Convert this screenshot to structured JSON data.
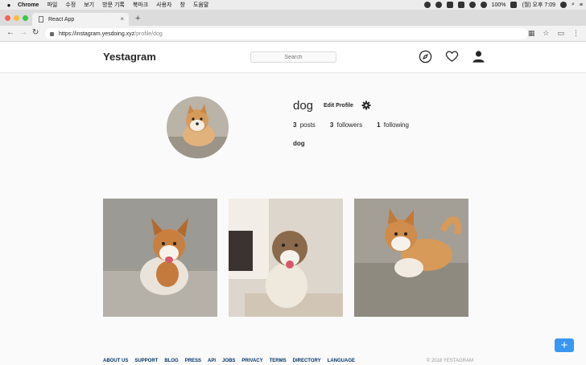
{
  "menubar": {
    "app": "Chrome",
    "items": [
      "파일",
      "수정",
      "보기",
      "방문 기록",
      "북마크",
      "사용자",
      "창",
      "도움말"
    ],
    "battery": "100%",
    "clock": "(월) 오후 7:09"
  },
  "browser": {
    "tab_title": "React App",
    "tab_close": "×",
    "new_tab": "+",
    "url_host": "https://instagram.yesdoing.xyz",
    "url_path": "/profile/dog"
  },
  "header": {
    "logo": "Yestagram",
    "search_placeholder": "Search",
    "icons": [
      "compass-icon",
      "heart-icon",
      "user-icon"
    ]
  },
  "profile": {
    "username": "dog",
    "edit_label": "Edit Profile",
    "posts_count": "3",
    "posts_label": "posts",
    "followers_count": "3",
    "followers_label": "followers",
    "following_count": "1",
    "following_label": "following",
    "fullname": "dog"
  },
  "footer": {
    "links": [
      "ABOUT US",
      "SUPPORT",
      "BLOG",
      "PRESS",
      "API",
      "JOBS",
      "PRIVACY",
      "TERMS",
      "DIRECTORY",
      "LANGUAGE"
    ],
    "copyright": "© 2018 YESTAGRAM"
  },
  "fab_label": "+",
  "colors": {
    "accent": "#3897f0",
    "link": "#003569"
  }
}
